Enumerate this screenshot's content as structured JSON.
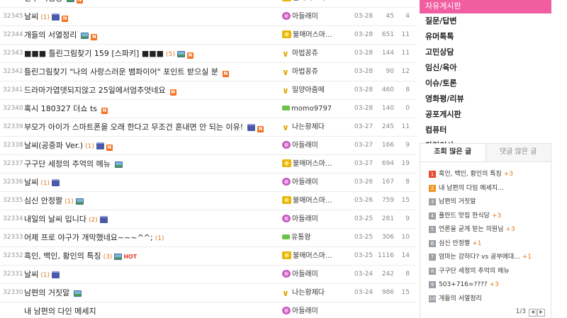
{
  "board": {
    "rows": [
      {
        "no": "32346",
        "title": "선수 비빔빵",
        "cmt": "",
        "icons": [
          "img",
          "new"
        ],
        "author": "불매머스마...",
        "lv": "gold",
        "date": "02-34",
        "views": "165",
        "rec": "12"
      },
      {
        "no": "32345",
        "title": "날씨",
        "cmt": "(1)",
        "icons": [
          "mov",
          "new"
        ],
        "author": "아들래미",
        "lv": "pink",
        "date": "03-28",
        "views": "45",
        "rec": "4"
      },
      {
        "no": "32344",
        "title": "개들의 서열정리",
        "cmt": "",
        "icons": [
          "img",
          "new"
        ],
        "author": "불매머스마...",
        "lv": "gold",
        "date": "03-28",
        "views": "651",
        "rec": "11"
      },
      {
        "no": "32343",
        "title": "■■■ 틀린그림찾기 159 [스파키] ■■■",
        "cmt": "(5)",
        "icons": [
          "img",
          "new"
        ],
        "author": "마법꽁쥬",
        "lv": "chev",
        "date": "03-28",
        "views": "144",
        "rec": "11"
      },
      {
        "no": "32342",
        "title": "틀린그림찾기 \"나의 사랑스러운 뱀파이어\" 포인트 받으실 분",
        "cmt": "",
        "icons": [
          "new"
        ],
        "author": "마법꽁쥬",
        "lv": "chev",
        "date": "03-28",
        "views": "90",
        "rec": "12"
      },
      {
        "no": "32341",
        "title": "드라마가엽뎃되지않고 25일에서엄추엇네요",
        "cmt": "",
        "icons": [
          "new"
        ],
        "author": "밀양아줌메",
        "lv": "chev",
        "date": "03-28",
        "views": "460",
        "rec": "8"
      },
      {
        "no": "32340",
        "title": "혹시 180327 더쇼 ts",
        "cmt": "",
        "icons": [
          "new"
        ],
        "author": "momo9797",
        "lv": "green",
        "date": "03-28",
        "views": "140",
        "rec": "0"
      },
      {
        "no": "32339",
        "title": "부모가 아이가 스마트폰을 오래 한다고 무조건 혼내면 안 되는 이유!",
        "cmt": "",
        "icons": [
          "mov",
          "new"
        ],
        "author": "나는황제다",
        "lv": "chev",
        "date": "03-27",
        "views": "245",
        "rec": "11"
      },
      {
        "no": "32338",
        "title": "날씨(공중파 Ver.)",
        "cmt": "(1)",
        "icons": [
          "mov",
          "new"
        ],
        "author": "아들래미",
        "lv": "pink",
        "date": "03-27",
        "views": "166",
        "rec": "9"
      },
      {
        "no": "32337",
        "title": "구구단 세정의 추억의 메뉴",
        "cmt": "",
        "icons": [
          "img"
        ],
        "author": "불매머스마...",
        "lv": "gold",
        "date": "03-27",
        "views": "694",
        "rec": "19"
      },
      {
        "no": "32336",
        "title": "날씨",
        "cmt": "(1)",
        "icons": [
          "mov"
        ],
        "author": "아들래미",
        "lv": "pink",
        "date": "03-26",
        "views": "167",
        "rec": "8"
      },
      {
        "no": "32335",
        "title": "심신 안정짤",
        "cmt": "(1)",
        "icons": [
          "img"
        ],
        "author": "불매머스마...",
        "lv": "gold",
        "date": "03-26",
        "views": "759",
        "rec": "15"
      },
      {
        "no": "32334",
        "title": "내일의 날씨 입니다",
        "cmt": "(2)",
        "icons": [
          "mov"
        ],
        "author": "아들래미",
        "lv": "pink",
        "date": "03-25",
        "views": "281",
        "rec": "9"
      },
      {
        "no": "32333",
        "title": "어제 프로 야구가 개막했네요~~~^^;",
        "cmt": "(1)",
        "icons": [],
        "author": "유통왕",
        "lv": "green",
        "date": "03-25",
        "views": "306",
        "rec": "10"
      },
      {
        "no": "32332",
        "title": "흑인, 백인, 황인의 특징",
        "cmt": "(3)",
        "icons": [
          "img",
          "hot"
        ],
        "author": "불매머스마...",
        "lv": "gold",
        "date": "03-25",
        "views": "1116",
        "rec": "14"
      },
      {
        "no": "32331",
        "title": "날씨",
        "cmt": "(1)",
        "icons": [
          "mov"
        ],
        "author": "아들래미",
        "lv": "pink",
        "date": "03-24",
        "views": "242",
        "rec": "8"
      },
      {
        "no": "32330",
        "title": "남편의 거짓말",
        "cmt": "",
        "icons": [
          "img"
        ],
        "author": "나는황제다",
        "lv": "chev",
        "date": "03-24",
        "views": "986",
        "rec": "15"
      },
      {
        "no": "",
        "title": "내 남편의 다인 메세지",
        "cmt": "",
        "icons": [],
        "author": "아들래미",
        "lv": "pink",
        "date": "",
        "views": "",
        "rec": ""
      }
    ]
  },
  "categories": [
    {
      "label": "자유게시판",
      "active": true
    },
    {
      "label": "질문/답변"
    },
    {
      "label": "유머톡톡"
    },
    {
      "label": "고민상담"
    },
    {
      "label": "임신/육아"
    },
    {
      "label": "이슈/토론"
    },
    {
      "label": "영화평/리뷰"
    },
    {
      "label": "공포게시판"
    },
    {
      "label": "컴퓨터"
    },
    {
      "label": "가입인사"
    }
  ],
  "popular": {
    "tab_views": "조회 많은 글",
    "tab_comments": "댓글 많은 글",
    "items": [
      {
        "rank": "1",
        "title": "흑인, 백인, 황인의 특징",
        "plus": "+3"
      },
      {
        "rank": "2",
        "title": "내 남편의 다임 메세지...",
        "plus": ""
      },
      {
        "rank": "3",
        "title": "남편의 거짓말",
        "plus": ""
      },
      {
        "rank": "4",
        "title": "폴란드 맛집 한식당",
        "plus": "+3"
      },
      {
        "rank": "5",
        "title": "언론을 굳게 믿는 의원님",
        "plus": "+3"
      },
      {
        "rank": "6",
        "title": "심신 안정짤",
        "plus": "+1"
      },
      {
        "rank": "7",
        "title": "엄마는 강하다? vs 공부에대...",
        "plus": "+1"
      },
      {
        "rank": "8",
        "title": "구구단 세정의 추억의 메뉴",
        "plus": ""
      },
      {
        "rank": "9",
        "title": "503+716=????",
        "plus": "+3"
      },
      {
        "rank": "10",
        "title": "개들의 서열정리",
        "plus": ""
      }
    ],
    "pager": "1/3",
    "prev": "◀",
    "next": "▶"
  },
  "colors": {
    "accent": "#f05ea0",
    "comment": "#e27a20",
    "new_badge": "#f4711e",
    "hot": "#e53b2e"
  }
}
